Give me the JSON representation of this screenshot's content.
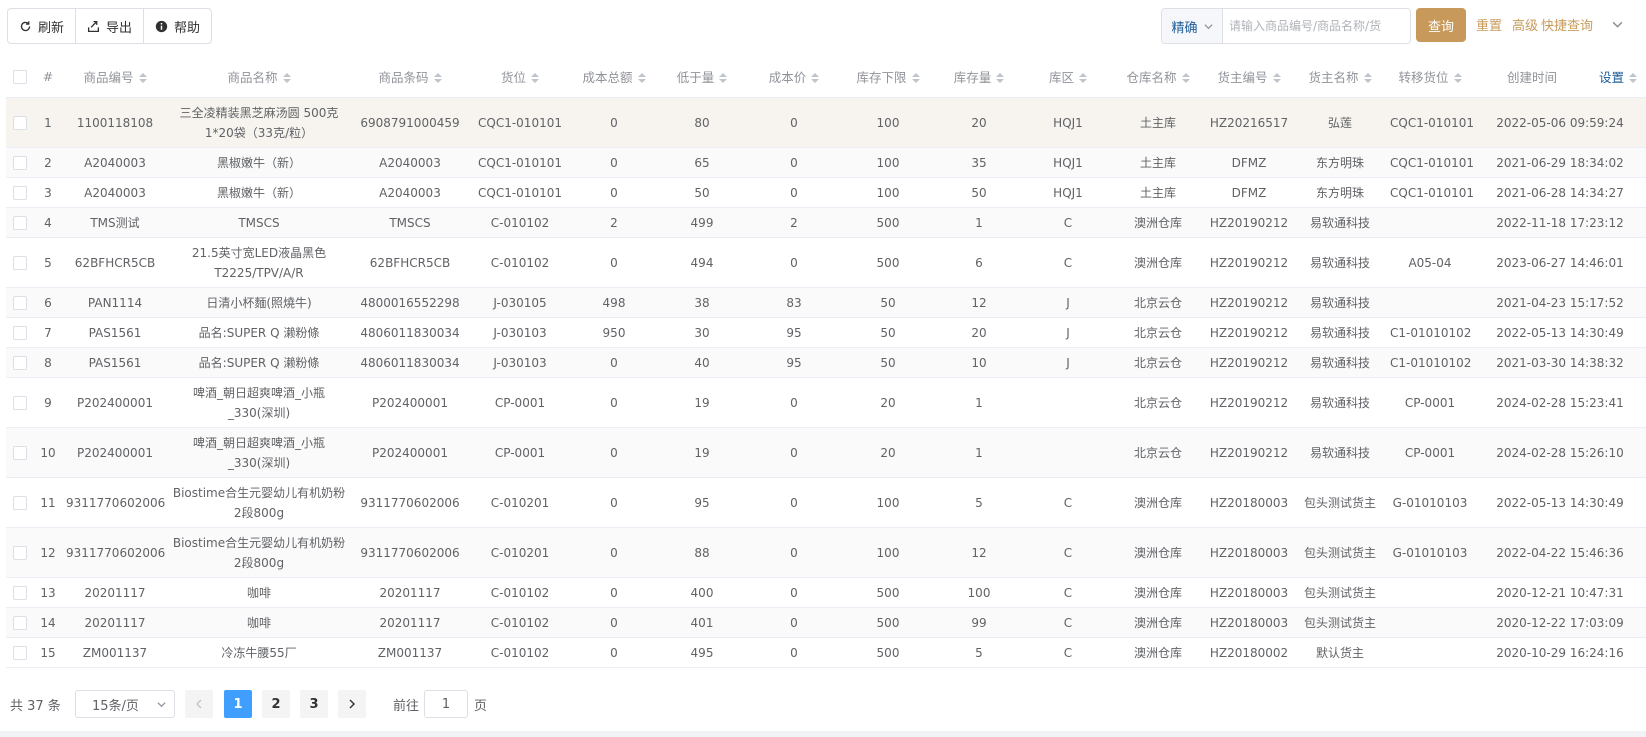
{
  "toolbar": {
    "refresh_label": "刷新",
    "export_label": "导出",
    "help_label": "帮助"
  },
  "search": {
    "mode_label": "精确",
    "placeholder": "请输入商品编号/商品名称/货",
    "query_label": "查询",
    "reset_label": "重置",
    "advanced_label": "高级",
    "quick_query_label": "快捷查询"
  },
  "colors": {
    "accent": "#c79a5b",
    "link": "#1f5d99",
    "active_page": "#409eff",
    "row_highlight": "#f7f4ef"
  },
  "table": {
    "columns": [
      "#",
      "商品编号",
      "商品名称",
      "商品条码",
      "货位",
      "成本总额",
      "低于量",
      "成本价",
      "库存下限",
      "库存量",
      "库区",
      "仓库名称",
      "货主编号",
      "货主名称",
      "转移货位",
      "创建时间"
    ],
    "settings_label": "设置",
    "rows": [
      [
        "1",
        "1100118108",
        "三全凌精装黑芝麻汤圆 500克 1*20袋（33克/粒）",
        "6908791000459",
        "CQC1-010101",
        "0",
        "80",
        "0",
        "100",
        "20",
        "HQJ1",
        "土主库",
        "HZ20216517",
        "弘莲",
        "CQC1-010101",
        "2022-05-06 09:59:24"
      ],
      [
        "2",
        "A2040003",
        "黑椒嫩牛（新）",
        "A2040003",
        "CQC1-010101",
        "0",
        "65",
        "0",
        "100",
        "35",
        "HQJ1",
        "土主库",
        "DFMZ",
        "东方明珠",
        "CQC1-010101",
        "2021-06-29 18:34:02"
      ],
      [
        "3",
        "A2040003",
        "黑椒嫩牛（新）",
        "A2040003",
        "CQC1-010101",
        "0",
        "50",
        "0",
        "100",
        "50",
        "HQJ1",
        "土主库",
        "DFMZ",
        "东方明珠",
        "CQC1-010101",
        "2021-06-28 14:34:27"
      ],
      [
        "4",
        "TMS测试",
        "TMSCS",
        "TMSCS",
        "C-010102",
        "2",
        "499",
        "2",
        "500",
        "1",
        "C",
        "澳洲仓库",
        "HZ20190212",
        "易软通科技",
        "",
        "2022-11-18 17:23:12"
      ],
      [
        "5",
        "62BFHCR5CB",
        "21.5英寸宽LED液晶黑色T2225/TPV/A/R",
        "62BFHCR5CB",
        "C-010102",
        "0",
        "494",
        "0",
        "500",
        "6",
        "C",
        "澳洲仓库",
        "HZ20190212",
        "易软通科技",
        "A05-04",
        "2023-06-27 14:46:01"
      ],
      [
        "6",
        "PAN1114",
        "日清小杯麵(照燒牛)",
        "4800016552298",
        "J-030105",
        "498",
        "38",
        "83",
        "50",
        "12",
        "J",
        "北京云仓",
        "HZ20190212",
        "易软通科技",
        "",
        "2021-04-23 15:17:52"
      ],
      [
        "7",
        "PAS1561",
        "品名:SUPER Q 濑粉條",
        "4806011830034",
        "J-030103",
        "950",
        "30",
        "95",
        "50",
        "20",
        "J",
        "北京云仓",
        "HZ20190212",
        "易软通科技",
        "C1-01010102",
        "2022-05-13 14:30:49"
      ],
      [
        "8",
        "PAS1561",
        "品名:SUPER Q 濑粉條",
        "4806011830034",
        "J-030103",
        "0",
        "40",
        "95",
        "50",
        "10",
        "J",
        "北京云仓",
        "HZ20190212",
        "易软通科技",
        "C1-01010102",
        "2021-03-30 14:38:32"
      ],
      [
        "9",
        "P202400001",
        "啤酒_朝日超爽啤酒_小瓶_330(深圳)",
        "P202400001",
        "CP-0001",
        "0",
        "19",
        "0",
        "20",
        "1",
        "",
        "北京云仓",
        "HZ20190212",
        "易软通科技",
        "CP-0001",
        "2024-02-28 15:23:41"
      ],
      [
        "10",
        "P202400001",
        "啤酒_朝日超爽啤酒_小瓶_330(深圳)",
        "P202400001",
        "CP-0001",
        "0",
        "19",
        "0",
        "20",
        "1",
        "",
        "北京云仓",
        "HZ20190212",
        "易软通科技",
        "CP-0001",
        "2024-02-28 15:26:10"
      ],
      [
        "11",
        "9311770602006",
        "Biostime合生元婴幼儿有机奶粉2段800g",
        "9311770602006",
        "C-010201",
        "0",
        "95",
        "0",
        "100",
        "5",
        "C",
        "澳洲仓库",
        "HZ20180003",
        "包头测试货主",
        "G-01010103",
        "2022-05-13 14:30:49"
      ],
      [
        "12",
        "9311770602006",
        "Biostime合生元婴幼儿有机奶粉2段800g",
        "9311770602006",
        "C-010201",
        "0",
        "88",
        "0",
        "100",
        "12",
        "C",
        "澳洲仓库",
        "HZ20180003",
        "包头测试货主",
        "G-01010103",
        "2022-04-22 15:46:36"
      ],
      [
        "13",
        "20201117",
        "咖啡",
        "20201117",
        "C-010102",
        "0",
        "400",
        "0",
        "500",
        "100",
        "C",
        "澳洲仓库",
        "HZ20180003",
        "包头测试货主",
        "",
        "2020-12-21 10:47:31"
      ],
      [
        "14",
        "20201117",
        "咖啡",
        "20201117",
        "C-010102",
        "0",
        "401",
        "0",
        "500",
        "99",
        "C",
        "澳洲仓库",
        "HZ20180003",
        "包头测试货主",
        "",
        "2020-12-22 17:03:09"
      ],
      [
        "15",
        "ZM001137",
        "冷冻牛腰55厂",
        "ZM001137",
        "C-010102",
        "0",
        "495",
        "0",
        "500",
        "5",
        "C",
        "澳洲仓库",
        "HZ20180002",
        "默认货主",
        "",
        "2020-10-29 16:24:16"
      ]
    ]
  },
  "pagination": {
    "total_label": "共 37 条",
    "page_size_label": "15条/页",
    "pages": [
      "1",
      "2",
      "3"
    ],
    "current_page": "1",
    "goto_label": "前往",
    "goto_value": "1",
    "page_suffix": "页"
  }
}
